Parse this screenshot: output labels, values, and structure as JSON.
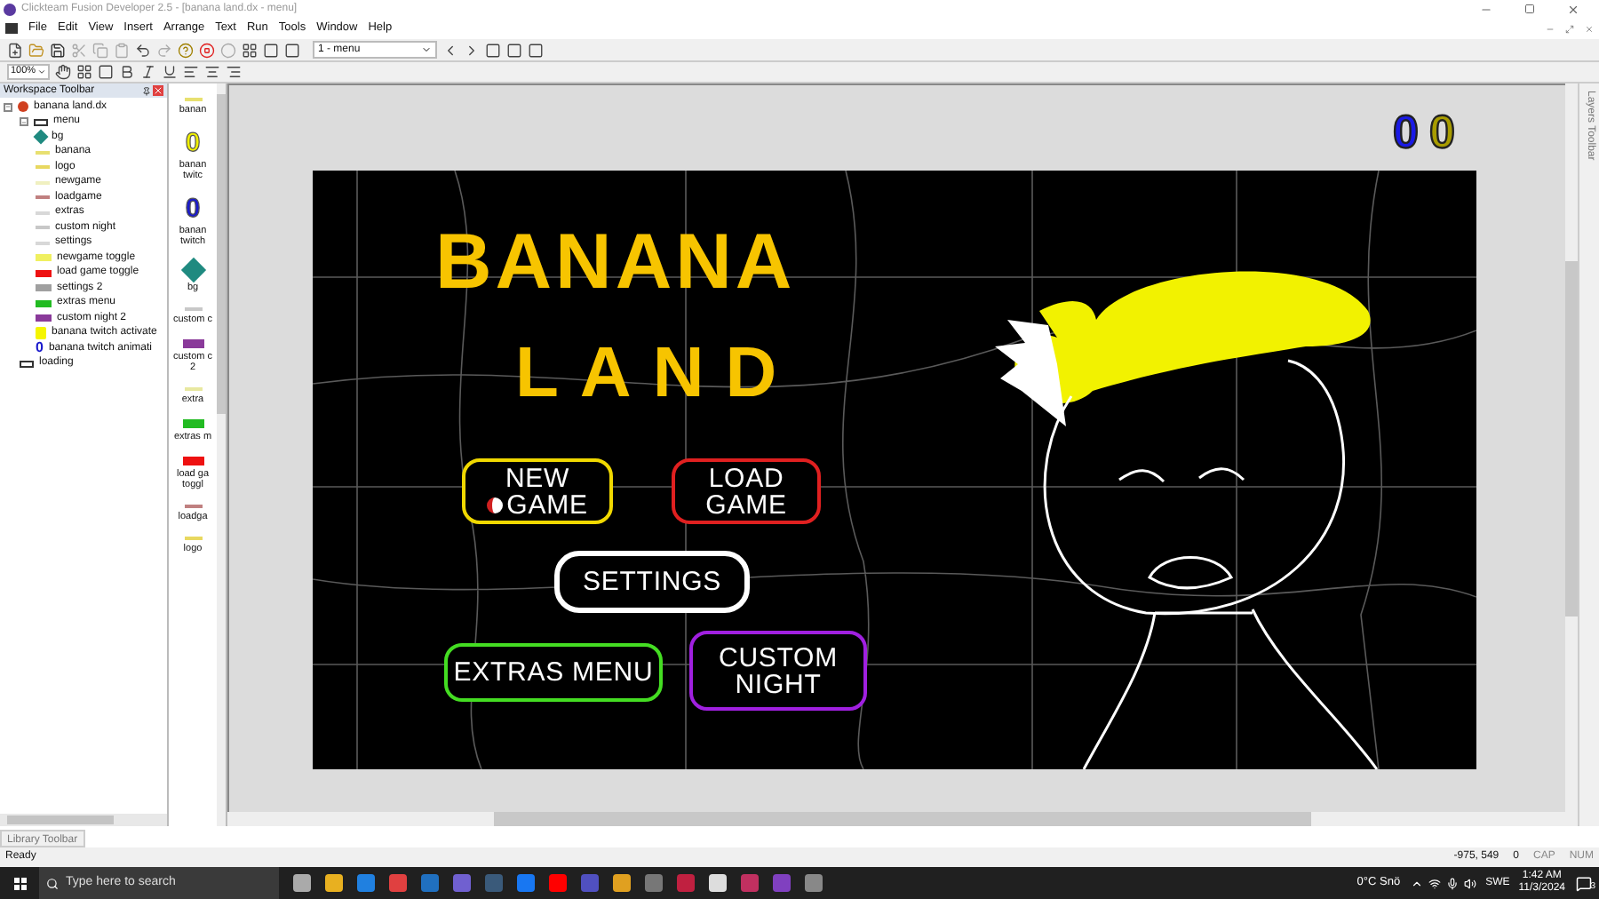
{
  "window": {
    "title": "Clickteam Fusion Developer 2.5 - [banana land.dx - menu]"
  },
  "menu_bar": [
    "File",
    "Edit",
    "View",
    "Insert",
    "Arrange",
    "Text",
    "Run",
    "Tools",
    "Window",
    "Help"
  ],
  "toolbar": {
    "frame_select": "1 - menu",
    "zoom": "100%"
  },
  "workspace": {
    "title": "Workspace Toolbar",
    "tree": [
      {
        "label": "banana land.dx",
        "kind": "app",
        "expanded": true,
        "children": [
          {
            "label": "menu",
            "kind": "frame",
            "expanded": true,
            "children": [
              {
                "label": "bg",
                "kind": "diamond",
                "color": "#1f8a80"
              },
              {
                "label": "banana",
                "kind": "line",
                "color": "#e8e070"
              },
              {
                "label": "logo",
                "kind": "line",
                "color": "#e8d860"
              },
              {
                "label": "newgame",
                "kind": "line",
                "color": "#f0f0c0"
              },
              {
                "label": "loadgame",
                "kind": "line",
                "color": "#c08080"
              },
              {
                "label": "extras",
                "kind": "line",
                "color": "#d8d8d8"
              },
              {
                "label": "custom night",
                "kind": "line",
                "color": "#c8c8c8"
              },
              {
                "label": "settings",
                "kind": "line",
                "color": "#d8d8d8"
              },
              {
                "label": "newgame toggle",
                "kind": "bar",
                "color": "#f0f060"
              },
              {
                "label": "load game toggle",
                "kind": "bar",
                "color": "#ee1111"
              },
              {
                "label": "settings 2",
                "kind": "bar",
                "color": "#a0a0a0"
              },
              {
                "label": "extras menu",
                "kind": "bar",
                "color": "#22bb22"
              },
              {
                "label": "custom night 2",
                "kind": "bar",
                "color": "#8a3a9a"
              },
              {
                "label": "banana twitch activate",
                "kind": "block",
                "color": "#f5f500"
              },
              {
                "label": "banana twitch animati",
                "kind": "digit",
                "glyph": "0",
                "color": "#1a1acc"
              }
            ]
          },
          {
            "label": "loading",
            "kind": "frame"
          }
        ]
      }
    ]
  },
  "object_strip": [
    {
      "label": "banan",
      "kind": "line",
      "color": "#e8e070"
    },
    {
      "label": "banan twitc",
      "kind": "digit",
      "glyph": "0",
      "color": "#f0f000"
    },
    {
      "label": "banan twitch",
      "kind": "digit",
      "glyph": "0",
      "color": "#1a1acc"
    },
    {
      "label": "bg",
      "kind": "diamond",
      "color": "#1f8a80"
    },
    {
      "label": "custom c",
      "kind": "line",
      "color": "#c8c8c8"
    },
    {
      "label": "custom c 2",
      "kind": "bar",
      "color": "#8a3a9a"
    },
    {
      "label": "extra",
      "kind": "line",
      "color": "#e8e8a0"
    },
    {
      "label": "extras m",
      "kind": "bar",
      "color": "#22bb22"
    },
    {
      "label": "load ga toggl",
      "kind": "bar",
      "color": "#ee1111"
    },
    {
      "label": "loadga",
      "kind": "line",
      "color": "#c08080"
    },
    {
      "label": "logo",
      "kind": "line",
      "color": "#e8d860"
    }
  ],
  "frame_editor": {
    "counters": [
      {
        "text": "0",
        "color": "#1a1ae6"
      },
      {
        "text": "0",
        "color": "#a89c00"
      }
    ],
    "logo": [
      "BANANA",
      "LAND"
    ],
    "buttons": [
      {
        "lines": [
          "NEW",
          "GAME"
        ],
        "color": "#f0d800",
        "kind": "pill"
      },
      {
        "lines": [
          "LOAD",
          "GAME"
        ],
        "color": "#e02020",
        "kind": "pill"
      },
      {
        "lines": [
          "SETTINGS"
        ],
        "color": "#ffffff",
        "kind": "cloud"
      },
      {
        "lines": [
          "EXTRAS MENU"
        ],
        "color": "#44dd22",
        "kind": "pill"
      },
      {
        "lines": [
          "CUSTOM",
          "NIGHT"
        ],
        "color": "#a020e0",
        "kind": "pill"
      }
    ]
  },
  "layers_tab": "Layers Toolbar",
  "library_tab": "Library Toolbar",
  "status_bar": {
    "message": "Ready",
    "coordinates": "-975, 549",
    "layer": "0",
    "caps": "CAP",
    "num": "NUM"
  },
  "taskbar": {
    "search_placeholder": "Type here to search",
    "weather": "0°C Snö",
    "language": "SWE",
    "time": "1:42 AM",
    "date": "11/3/2024",
    "notifications": "3"
  }
}
